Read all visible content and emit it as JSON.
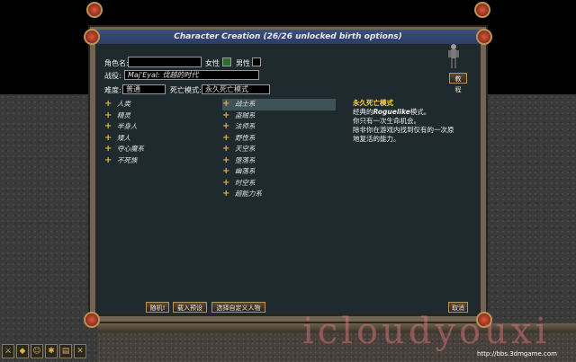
{
  "window": {
    "title": "Character Creation (26/26 unlocked birth options)"
  },
  "form": {
    "name_label": "角色名:",
    "name_value": "",
    "female_label": "女性",
    "male_label": "男性",
    "campaign_label": "战役:",
    "campaign_value": "Maj'Eyal: 伐越的时代",
    "difficulty_label": "难度:",
    "difficulty_value": "普通",
    "permadeath_label": "死亡模式:",
    "permadeath_value": "永久死亡模式"
  },
  "races": [
    "人类",
    "精灵",
    "半身人",
    "矮人",
    "夺心魔系",
    "不死族"
  ],
  "classes": [
    "战士系",
    "盗贼系",
    "法师系",
    "野性系",
    "天空系",
    "堕落系",
    "幽落系",
    "时空系",
    "超能力系"
  ],
  "description": {
    "heading": "永久死亡模式",
    "line1_a": "经典的",
    "line1_b": "Roguelike",
    "line1_c": "模式。",
    "line2": "你只有一次生命机会。",
    "line3": "除非你在游戏内找到仅有的一次原",
    "line4": "地复活的能力。"
  },
  "buttons": {
    "tutorial": "教程",
    "random": "随机!",
    "load_preset": "载入预设",
    "custom_tiles": "选择自定义人物",
    "cancel": "取消"
  },
  "overlay": {
    "watermark": "icloudyouxi",
    "url": "http://bbs.3dmgame.com"
  },
  "colors": {
    "selected": "#3f5258",
    "heading": "#ffd23a",
    "title_bar": "#2a3d66"
  }
}
